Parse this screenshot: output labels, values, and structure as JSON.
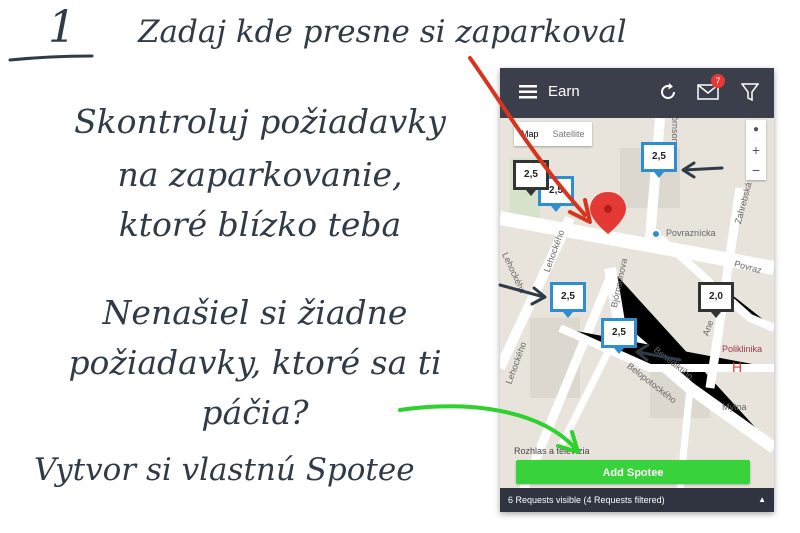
{
  "annotations": {
    "step_number": "1",
    "step_text": "Zadaj kde presne si zaparkoval",
    "check_lines": [
      "Skontroluj požiadavky",
      "na zaparkovanie,",
      "ktoré blízko teba"
    ],
    "none_lines": [
      "Nenašiel si žiadne",
      "požiadavky, ktoré sa ti",
      "páčia?"
    ],
    "create_line": "Vytvor si vlastnú Spotee"
  },
  "app": {
    "title": "Earn",
    "menu_icon": "hamburger-icon",
    "refresh_icon": "refresh-icon",
    "mail_icon": "envelope-icon",
    "mail_badge": "7",
    "filter_icon": "filter-icon"
  },
  "map": {
    "map_type_options": [
      "Map",
      "Satellite"
    ],
    "selected_map_type": "Map",
    "zoom_in": "+",
    "zoom_out": "−",
    "streets": [
      "Povraznícka",
      "Povraz",
      "Bjórnsonova",
      "Lehockého",
      "Lehockého",
      "Lehockého",
      "Zahrebská",
      "Benediktiho",
      "Belopotockého",
      "Mýtna",
      "Ane",
      "Bjórnsonova"
    ],
    "place_labels": [
      "Poliklinika",
      "Rozhlas a televízia"
    ],
    "spots": [
      {
        "label": "2,5",
        "style": "blue"
      },
      {
        "label": "2,5",
        "style": "blue"
      },
      {
        "label": "2,5",
        "style": "dark"
      },
      {
        "label": "2,5",
        "style": "blue"
      },
      {
        "label": "2,0",
        "style": "dark"
      },
      {
        "label": "2,5",
        "style": "blue"
      }
    ]
  },
  "actions": {
    "add_spotee": "Add Spotee"
  },
  "status": {
    "text": "6 Requests visible (4 Requests filtered)"
  },
  "colors": {
    "appbar": "#3a3f4b",
    "button": "#38d33a",
    "spot_blue": "#2d8fd0",
    "pin": "#e53935",
    "ink": "#2f3c48",
    "red_arrow": "#d8331c",
    "green_arrow": "#2ed12e"
  }
}
